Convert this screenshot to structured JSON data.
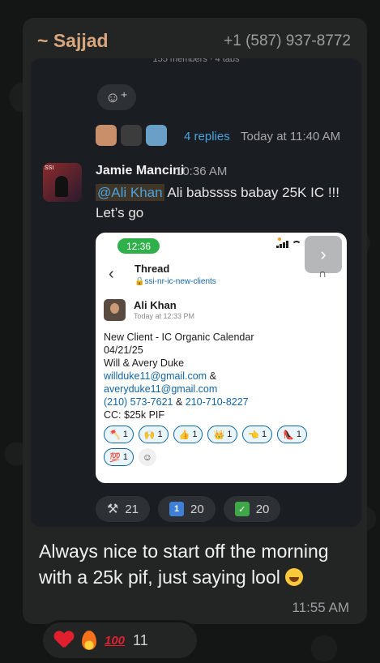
{
  "chat": {
    "sender_name": "~ Sajjad",
    "sender_phone": "+1 (587) 937-8772",
    "caption": "Always nice to start off the morning with a 25k pif, just saying lool",
    "time": "11:55 AM",
    "reactions": {
      "count": "11"
    }
  },
  "slack": {
    "top_partial": "155 members · 4 tabs",
    "thread_summary": {
      "replies": "4 replies",
      "time": "Today at 11:40 AM"
    },
    "message": {
      "author": "Jamie Mancini",
      "time": "10:36 AM",
      "mention": "@Ali Khan",
      "text": "Ali babssss babay 25K IC !!!",
      "text2": "Let’s go"
    },
    "bottom_reactions": [
      {
        "icon": "hammer-icon",
        "count": "21"
      },
      {
        "icon": "one-keycap-icon",
        "label": "1",
        "count": "20"
      },
      {
        "icon": "check-box-icon",
        "count": "20"
      }
    ]
  },
  "embed": {
    "clock": "12:36",
    "title": "Thread",
    "channel": "ssi-nr-ic-new-clients",
    "author": "Ali Khan",
    "time": "Today at 12:33 PM",
    "lines": {
      "l1": "New Client - IC Organic Calendar",
      "l2": "04/21/25",
      "l3": "Will & Avery Duke",
      "email1": "willduke11@gmail.com",
      "amp": " &",
      "email2": "averyduke11@gmail.com",
      "phone1": "(210) 573-7621",
      "amp2": " & ",
      "phone2": "210-710-8227",
      "l6": "CC: $25k PIF"
    },
    "chip_count": "1"
  }
}
